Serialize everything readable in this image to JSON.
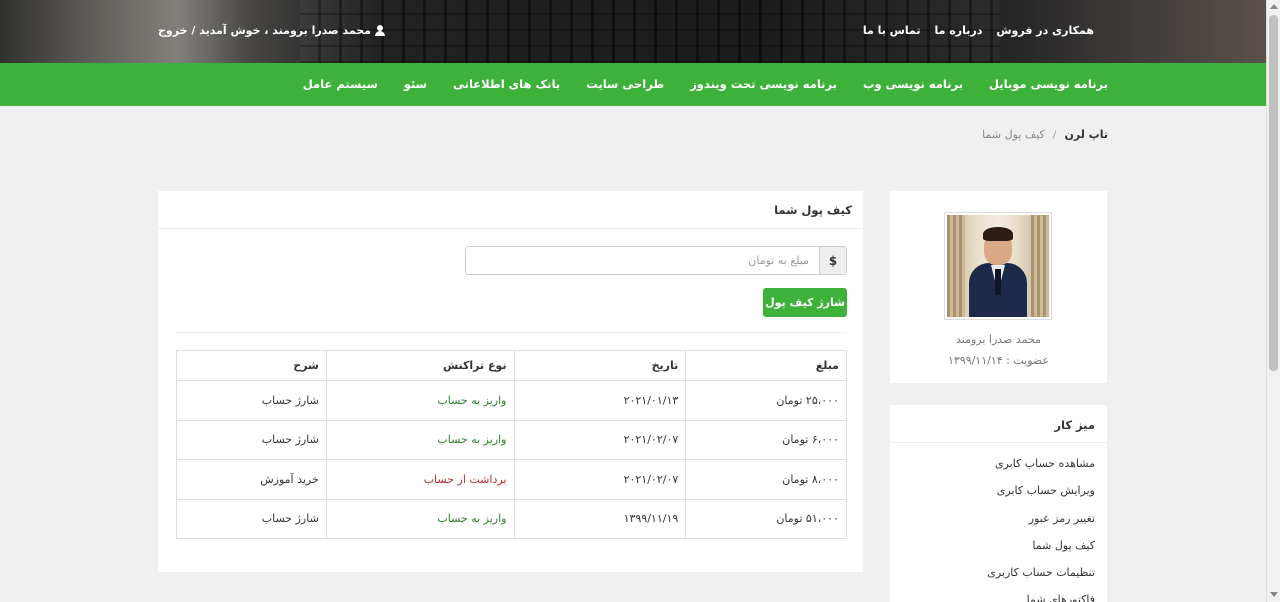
{
  "header": {
    "top_links": [
      "همکاری در فروش",
      "درباره ما",
      "تماس با ما"
    ],
    "user_text": "محمد صدرا برومند ، خوش آمدید / خروج"
  },
  "nav": {
    "items": [
      "برنامه نویسی موبایل",
      "برنامه نویسی وب",
      "برنامه نویسی تحت ویندوز",
      "طراحی سایت",
      "بانک های اطلاعاتی",
      "سئو",
      "سیستم عامل"
    ]
  },
  "breadcrumb": {
    "home": "تاپ لرن",
    "current": "کیف پول شما"
  },
  "wallet": {
    "title": "کیف پول شما",
    "currency_symbol": "$",
    "amount_placeholder": "مبلغ به تومان",
    "charge_button": "شارژ کیف پول",
    "table": {
      "headers": [
        "مبلغ",
        "تاریخ",
        "نوع تراکنش",
        "شرح"
      ],
      "rows": [
        {
          "amount": "۲۵،۰۰۰ تومان",
          "date": "۲۰۲۱/۰۱/۱۳",
          "type": "واریز به حساب",
          "desc": "شارژ حساب"
        },
        {
          "amount": "۶،۰۰۰ تومان",
          "date": "۲۰۲۱/۰۲/۰۷",
          "type": "واریز به حساب",
          "desc": "شارژ حساب"
        },
        {
          "amount": "۸،۰۰۰ تومان",
          "date": "۲۰۲۱/۰۲/۰۷",
          "type": "برداشت از حساب",
          "desc": "خرید آموزش"
        },
        {
          "amount": "۵۱،۰۰۰ تومان",
          "date": "۱۳۹۹/۱۱/۱۹",
          "type": "واریز به حساب",
          "desc": "شارژ حساب"
        }
      ]
    }
  },
  "profile": {
    "name": "محمد صدرا برومند",
    "membership": "عضویت : ۱۳۹۹/۱۱/۱۴"
  },
  "dashboard": {
    "title": "میز کار",
    "items": [
      "مشاهده حساب کابری",
      "ویرایش حساب کابری",
      "تغییر رمز عبور",
      "کیف پول شما",
      "تنظیمات حساب کاربری",
      "فاکتورهای شما"
    ]
  },
  "colors": {
    "nav_green": "#3db13a",
    "deposit_text": "#2f7d2b",
    "withdraw_text": "#b82a2a"
  }
}
